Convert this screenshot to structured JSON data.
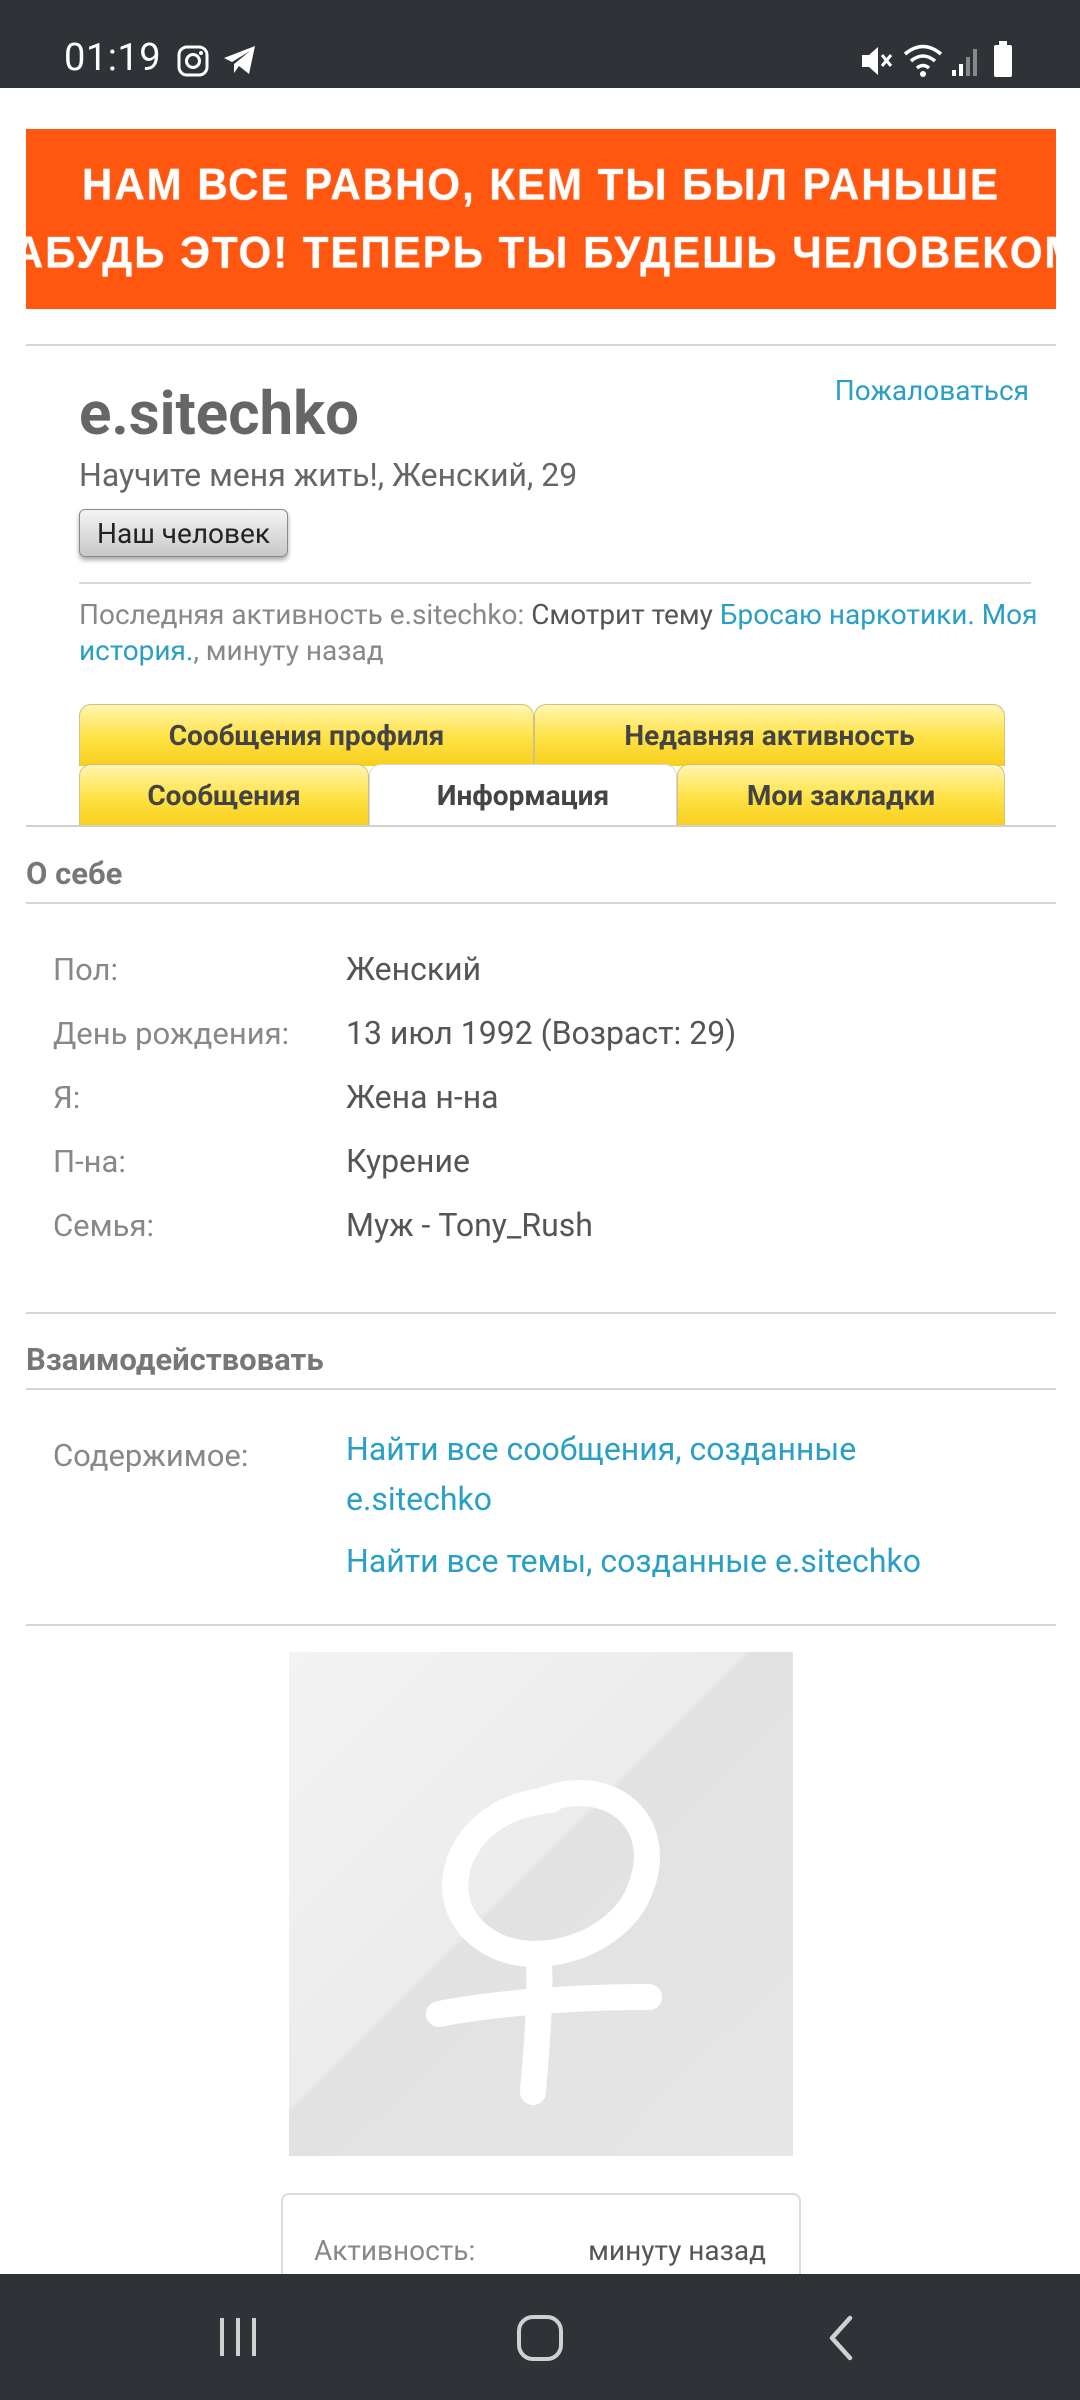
{
  "status_bar": {
    "time": "01:19",
    "icons": [
      "instagram-icon",
      "telegram-icon",
      "mute-icon",
      "wifi-icon",
      "signal-icon",
      "battery-icon"
    ]
  },
  "banner": {
    "line1": "НАМ ВСЕ РАВНО, КЕМ ТЫ БЫЛ РАНЬШЕ",
    "line2": "ЗАБУДЬ ЭТО! ТЕПЕРЬ ТЫ БУДЕШЬ ЧЕЛОВЕКОМ!",
    "background": "#ff5610"
  },
  "profile": {
    "username": "e.sitechko",
    "report_label": "Пожаловаться",
    "subtitle": "Научите меня жить!, Женский, 29",
    "user_title": "Наш человек",
    "last_activity": {
      "prefix": "Последняя активность e.sitechko:",
      "action": " Смотрит тему ",
      "thread_link": "Бросаю наркотики. Моя история.",
      "suffix": ", минуту назад"
    }
  },
  "tabs": {
    "row1": [
      "Сообщения профиля",
      "Недавняя активность"
    ],
    "row2": [
      "Сообщения",
      "Информация",
      "Мои закладки"
    ],
    "active": "Информация"
  },
  "about": {
    "title": "О себе",
    "rows": [
      {
        "label": "Пол:",
        "value": "Женский"
      },
      {
        "label": "День рождения:",
        "value": "13 июл 1992 (Возраст: 29)"
      },
      {
        "label": "Я:",
        "value": "Жена н-на"
      },
      {
        "label": "П-на:",
        "value": "Курение"
      },
      {
        "label": "Семья:",
        "value": "Муж - Tony_Rush"
      }
    ]
  },
  "interact": {
    "title": "Взаимодействовать",
    "label": "Содержимое:",
    "link1": "Найти все сообщения, созданные e.sitechko",
    "link2": "Найти все темы, созданные e.sitechko"
  },
  "stats": {
    "label": "Активность:",
    "value": "минуту назад"
  },
  "colors": {
    "accent_link": "#2a9fc5",
    "tab_yellow": "#ffe34a",
    "system_bar": "#2f3237"
  }
}
